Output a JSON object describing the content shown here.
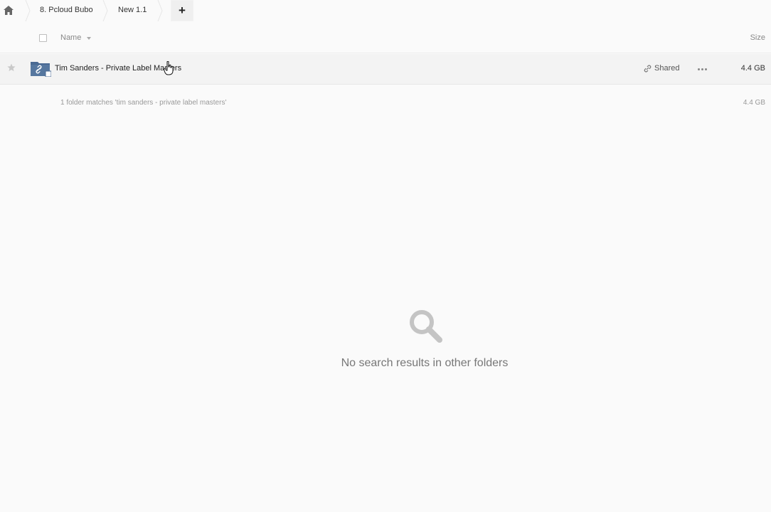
{
  "breadcrumb": {
    "items": [
      "8. Pcloud Bubo",
      "New 1.1"
    ],
    "add_label": "+"
  },
  "header": {
    "name_label": "Name",
    "size_label": "Size"
  },
  "rows": [
    {
      "name": "Tim Sanders - Private Label Masters",
      "shared_label": "Shared",
      "size": "4.4 GB",
      "icon": "shared-folder-icon"
    }
  ],
  "summary": {
    "text": "1 folder matches 'tim sanders - private label masters'",
    "size": "4.4 GB"
  },
  "empty_state": {
    "text": "No search results in other folders",
    "icon": "search-icon"
  },
  "colors": {
    "folder": "#4a6a93",
    "background": "#fafafa",
    "row_hover": "#f3f3f3"
  }
}
